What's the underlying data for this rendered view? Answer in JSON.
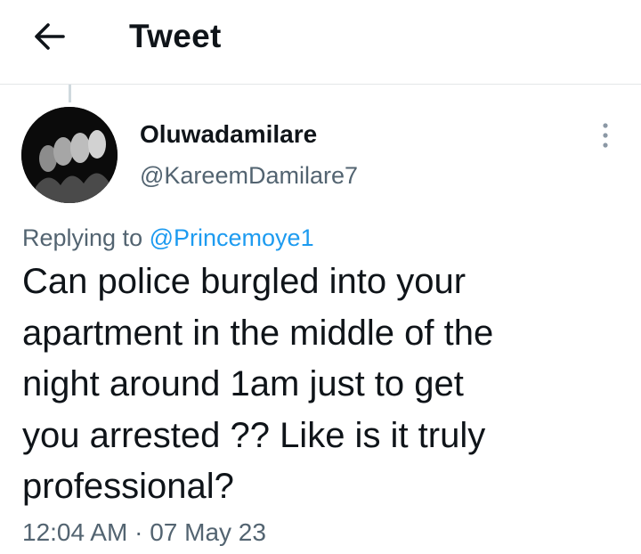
{
  "header": {
    "title": "Tweet",
    "back_icon": "arrow-left-icon"
  },
  "author": {
    "display_name": "Oluwadamilare",
    "handle": "@KareemDamilare7",
    "avatar_icon": "profile-avatar"
  },
  "more_icon": "more-vertical-icon",
  "reply": {
    "prefix": "Replying to",
    "target": "@Princemoye1"
  },
  "tweet": {
    "lines": [
      "Can police burgled into your",
      "apartment in the middle of the",
      "night around 1am just to get",
      "you arrested ?? Like is it truly",
      "professional?"
    ]
  },
  "meta": {
    "time": "12:04 AM",
    "separator": "·",
    "date": "07 May 23"
  },
  "colors": {
    "text": "#0f1419",
    "secondary": "#536471",
    "link": "#1d9bf0",
    "divider": "#e3e6e8"
  }
}
